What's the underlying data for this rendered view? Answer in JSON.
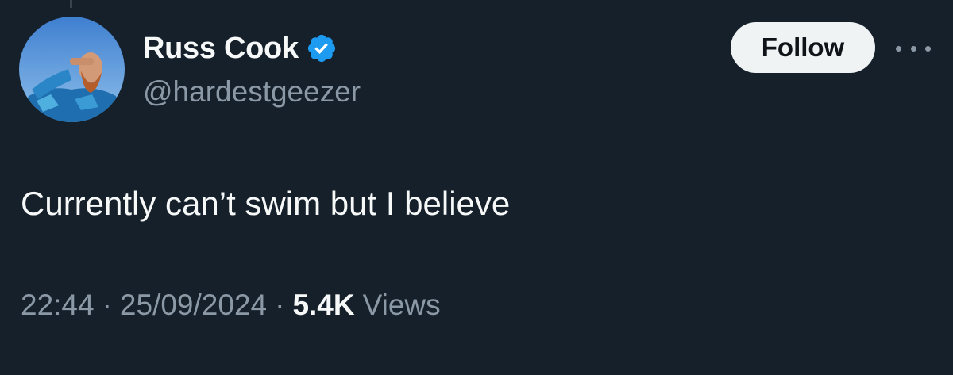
{
  "author": {
    "display_name": "Russ Cook",
    "handle": "@hardestgeezer",
    "verified_icon": "verified-badge-icon",
    "avatar": "avatar-photo"
  },
  "actions": {
    "follow_label": "Follow",
    "more_icon": "more-options-icon"
  },
  "tweet": {
    "text": "Currently can’t swim but I believe",
    "time": "22:44",
    "date": "25/09/2024",
    "separator": "·",
    "views_count": "5.4K",
    "views_label": "Views"
  },
  "colors": {
    "background": "#15202b",
    "primary_text": "#f7f9f9",
    "secondary_text": "#8b98a5",
    "verified_blue": "#1d9bf0",
    "follow_button_bg": "#eff3f4"
  }
}
